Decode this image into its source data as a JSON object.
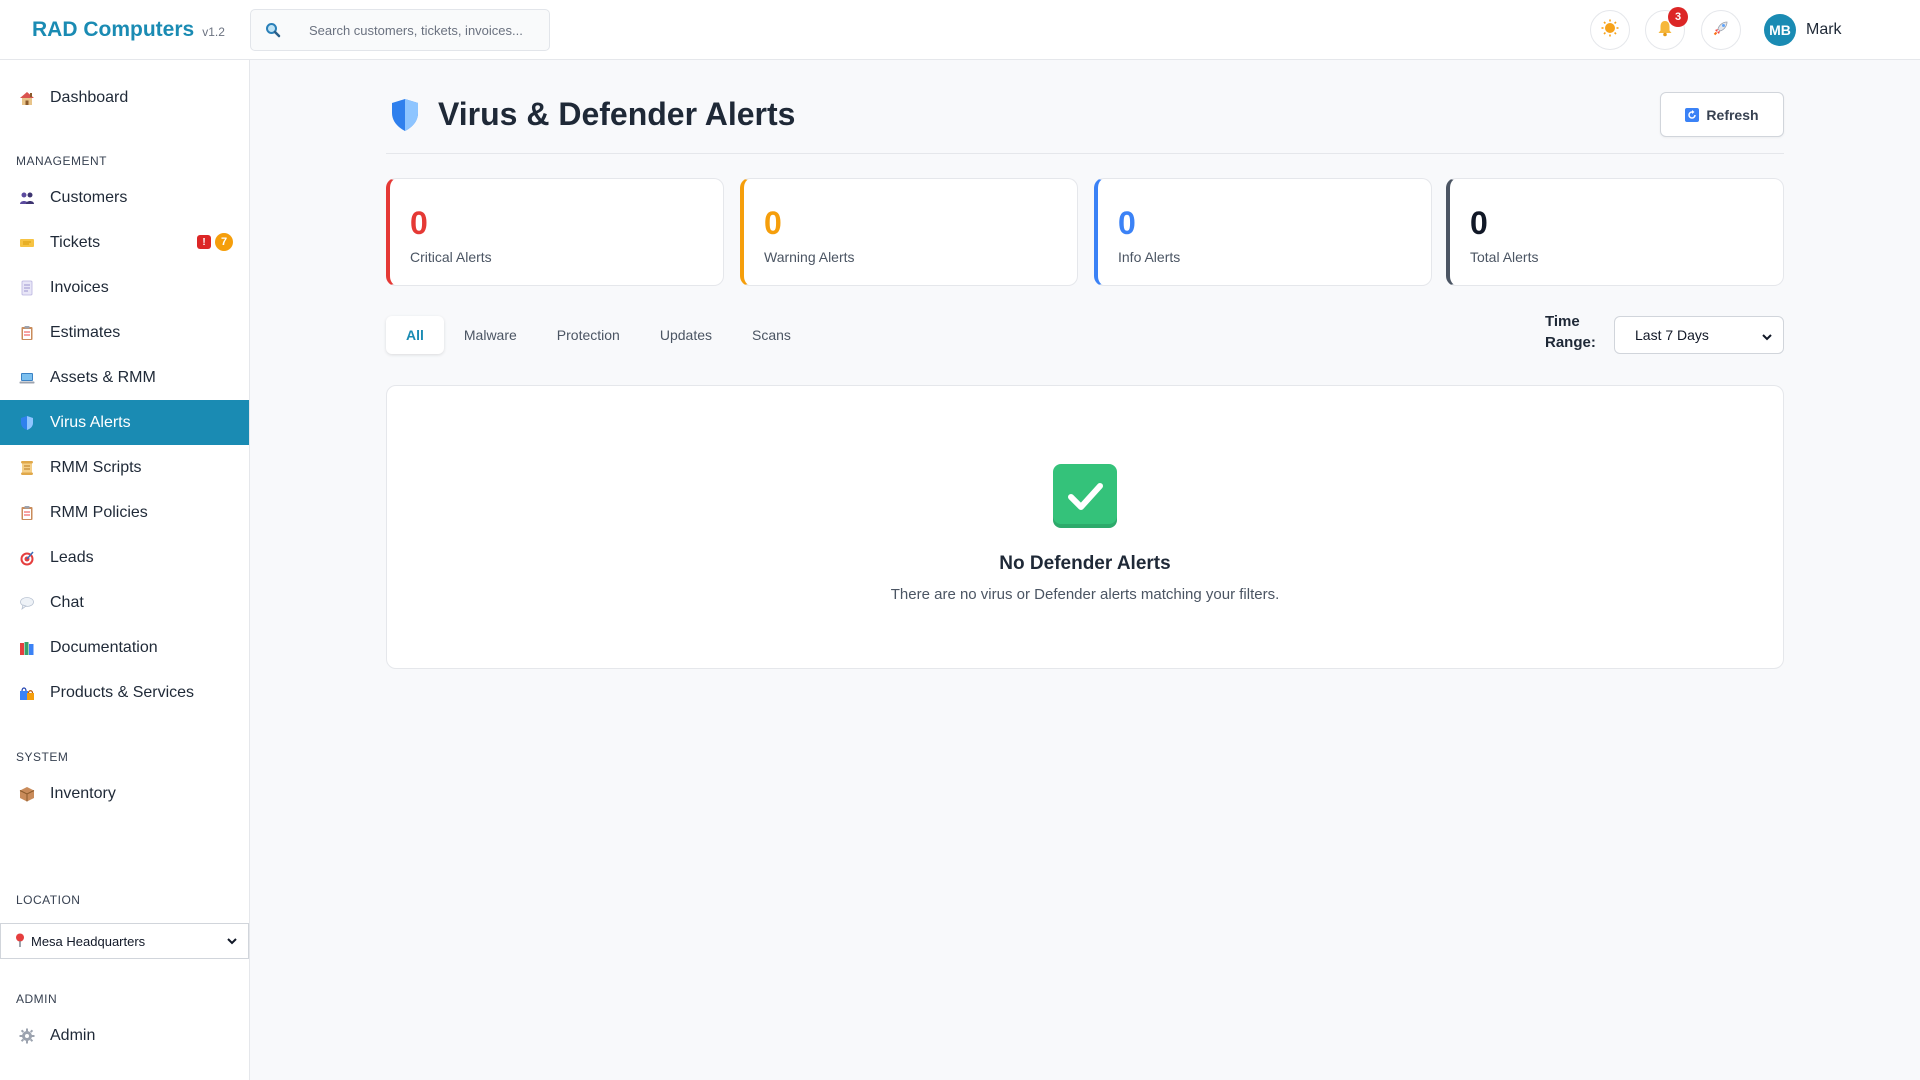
{
  "app": {
    "name": "RAD Computers",
    "version": "v1.2"
  },
  "search": {
    "placeholder": "Search customers, tickets, invoices..."
  },
  "topbar": {
    "notification_count": "3",
    "user_initials": "MB",
    "user_name": "Mark"
  },
  "sidebar": {
    "dashboard": "Dashboard",
    "management_label": "MANAGEMENT",
    "items": [
      {
        "label": "Customers",
        "icon": "people-icon"
      },
      {
        "label": "Tickets",
        "icon": "ticket-icon"
      },
      {
        "label": "Invoices",
        "icon": "invoice-icon"
      },
      {
        "label": "Estimates",
        "icon": "clipboard-icon"
      },
      {
        "label": "Assets & RMM",
        "icon": "laptop-icon"
      },
      {
        "label": "Virus Alerts",
        "icon": "shield-icon"
      },
      {
        "label": "RMM Scripts",
        "icon": "scroll-icon"
      },
      {
        "label": "RMM Policies",
        "icon": "clipboard-icon"
      },
      {
        "label": "Leads",
        "icon": "target-icon"
      },
      {
        "label": "Chat",
        "icon": "speech-bubble-icon"
      },
      {
        "label": "Documentation",
        "icon": "books-icon"
      },
      {
        "label": "Products & Services",
        "icon": "shopping-bags-icon"
      }
    ],
    "ticket_badge_alert": "!",
    "ticket_badge_count": "7",
    "system_label": "SYSTEM",
    "inventory": "Inventory",
    "location_label": "LOCATION",
    "location_value": "Mesa Headquarters",
    "admin_label": "ADMIN",
    "admin": "Admin"
  },
  "page": {
    "title": "Virus & Defender Alerts",
    "refresh_label": "Refresh"
  },
  "stats": [
    {
      "value": "0",
      "label": "Critical Alerts",
      "color": "#e53935"
    },
    {
      "value": "0",
      "label": "Warning Alerts",
      "color": "#f59e0b"
    },
    {
      "value": "0",
      "label": "Info Alerts",
      "color": "#3b82f6"
    },
    {
      "value": "0",
      "label": "Total Alerts",
      "color": "#4b5563"
    }
  ],
  "tabs": [
    "All",
    "Malware",
    "Protection",
    "Updates",
    "Scans"
  ],
  "active_tab": "All",
  "time_range": {
    "label": "Time Range:",
    "value": "Last 7 Days"
  },
  "empty": {
    "title": "No Defender Alerts",
    "description": "There are no virus or Defender alerts matching your filters."
  },
  "colors": {
    "accent": "#1a8bb3",
    "success": "#34c27a"
  }
}
